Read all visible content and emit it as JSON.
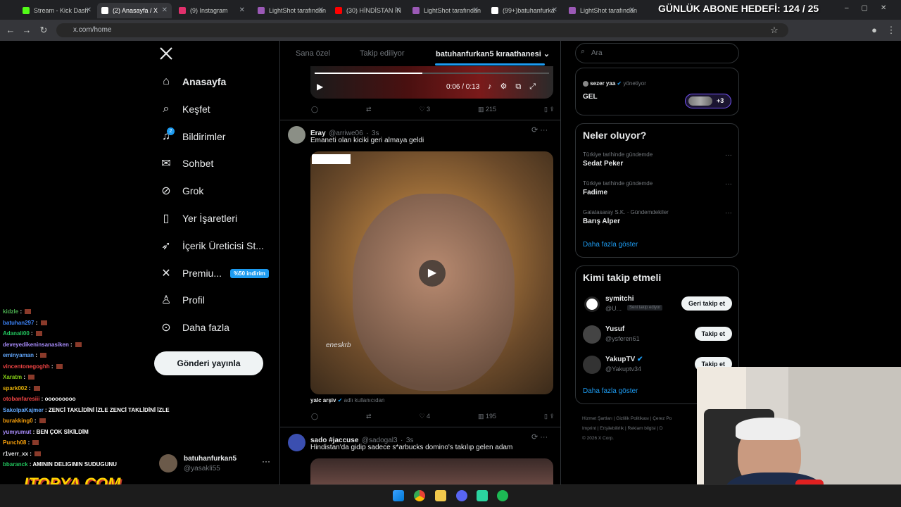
{
  "browser": {
    "tabs": [
      {
        "label": "Stream - Kick Dash",
        "color": "#53fc18"
      },
      {
        "label": "(2) Anasayfa / X",
        "color": "#ffffff"
      },
      {
        "label": "(9) Instagram",
        "color": "#e1306c"
      },
      {
        "label": "LightShot tarafından",
        "color": "#9b59b6"
      },
      {
        "label": "(30) HİNDİSTAN İN",
        "color": "#ff0000"
      },
      {
        "label": "LightShot tarafından",
        "color": "#9b59b6"
      },
      {
        "label": "(99+)batuhanfurka",
        "color": "#ffffff"
      },
      {
        "label": "LightShot tarafından",
        "color": "#9b59b6"
      }
    ],
    "url": "x.com/home"
  },
  "overlay": {
    "goal": "GÜNLÜK ABONE HEDEFİ: 124 / 25",
    "logo": "ITOPYA.COM"
  },
  "nav": {
    "items": [
      {
        "label": "Anasayfa",
        "icon": "home-icon"
      },
      {
        "label": "Keşfet",
        "icon": "search-icon"
      },
      {
        "label": "Bildirimler",
        "icon": "bell-icon",
        "badge": "2"
      },
      {
        "label": "Sohbet",
        "icon": "mail-icon"
      },
      {
        "label": "Grok",
        "icon": "grok-icon"
      },
      {
        "label": "Yer İşaretleri",
        "icon": "bookmark-icon"
      },
      {
        "label": "İçerik Üreticisi St...",
        "icon": "rocket-icon"
      },
      {
        "label": "Premiu...",
        "icon": "x-logo-icon"
      },
      {
        "label": "Profil",
        "icon": "person-icon"
      },
      {
        "label": "Daha fazla",
        "icon": "more-circle-icon"
      }
    ],
    "premium_badge": "%50 indirim",
    "post_button": "Gönderi yayınla",
    "account": {
      "name": "batuhanfurkan5",
      "handle": "@yasakli55"
    }
  },
  "main": {
    "tabs": [
      "Sana özel",
      "Takip ediliyor",
      "batuhanfurkan5 kıraathanesi"
    ],
    "video1": {
      "time": "0:06 / 0:13",
      "progress": 0.46
    },
    "tweet1_actions": {
      "replies": "",
      "retweets": "",
      "likes": "3",
      "views": "215"
    },
    "tweet2": {
      "name": "Eray",
      "handle": "@arriwe06",
      "time": "3s",
      "text": "Emaneti olan kiciki geri almaya geldi",
      "watermark": "eneskrb",
      "source_user": "yalc arşiv",
      "source_suffix": "adlı kullanıcıdan",
      "likes": "4",
      "views": "195"
    },
    "tweet3": {
      "name": "sado #jaccuse",
      "handle": "@sadogal3",
      "time": "3s",
      "text": "Hindistan'da gidip sadece s*arbucks domino's takılıp gelen adam"
    }
  },
  "right": {
    "search_placeholder": "Ara",
    "space": {
      "host": "sezer yaa",
      "role": "yönetiyor",
      "title": "GEL",
      "more": "+3"
    },
    "trends": {
      "title": "Neler oluyor?",
      "items": [
        {
          "context": "Türkiye tarihinde gündemde",
          "name": "Sedat Peker"
        },
        {
          "context": "Türkiye tarihinde gündemde",
          "name": "Fadime"
        },
        {
          "context": "Galatasaray S.K. · Gündemdekiler",
          "name": "Barış Alper"
        }
      ],
      "more": "Daha fazla göster"
    },
    "who_to_follow": {
      "title": "Kimi takip etmeli",
      "users": [
        {
          "name": "symitchi",
          "handle": "@U...",
          "note": "Seni takip ediyor",
          "button": "Geri takip et"
        },
        {
          "name": "Yusuf",
          "handle": "@ysferen61",
          "note": "",
          "button": "Takip et"
        },
        {
          "name": "YakupTV",
          "handle": "@Yakuptv34",
          "note": "",
          "button": "Takip et"
        }
      ],
      "more": "Daha fazla göster"
    },
    "footer": [
      "Hizmet Şartları",
      "Gizlilik Politikası",
      "Çerez Po",
      "Imprint",
      "Erişilebilirlik",
      "Reklam bilgisi",
      "D",
      "© 2026 X Corp."
    ]
  },
  "chat": [
    {
      "user": "kidzle",
      "msg": "",
      "color": "#4caf50"
    },
    {
      "user": "batuhan297",
      "msg": "",
      "color": "#3b82f6"
    },
    {
      "user": "Adanali00",
      "msg": "",
      "color": "#22c55e"
    },
    {
      "user": "deveyedikeninsanasiken",
      "msg": "",
      "color": "#a78bfa"
    },
    {
      "user": "eminyaman",
      "msg": "",
      "color": "#60a5fa"
    },
    {
      "user": "vincentonegoghh",
      "msg": "",
      "color": "#ef4444"
    },
    {
      "user": "Xaratm",
      "msg": "",
      "color": "#84cc16"
    },
    {
      "user": "spark002",
      "msg": "",
      "color": "#eab308"
    },
    {
      "user": "otobanfaresiii",
      "msg": "ooooooooo",
      "color": "#ef4444"
    },
    {
      "user": "SakolpaKajmer",
      "msg": "ZENCİ TAKLİDİNİ İZLE ZENCİ TAKLİDİNİ İZLE",
      "color": "#60a5fa"
    },
    {
      "user": "burakking0",
      "msg": "",
      "color": "#f59e0b"
    },
    {
      "user": "yumyumut",
      "msg": "BEN ÇOK SİKİLDİM",
      "color": "#a78bfa"
    },
    {
      "user": "Punch08",
      "msg": "",
      "color": "#f59e0b"
    },
    {
      "user": "r1verr_xx",
      "msg": "",
      "color": "#e7e9ea"
    },
    {
      "user": "bbaranck",
      "msg": "AMININ DELIGININ SUDUGUNU",
      "color": "#22c55e"
    }
  ]
}
